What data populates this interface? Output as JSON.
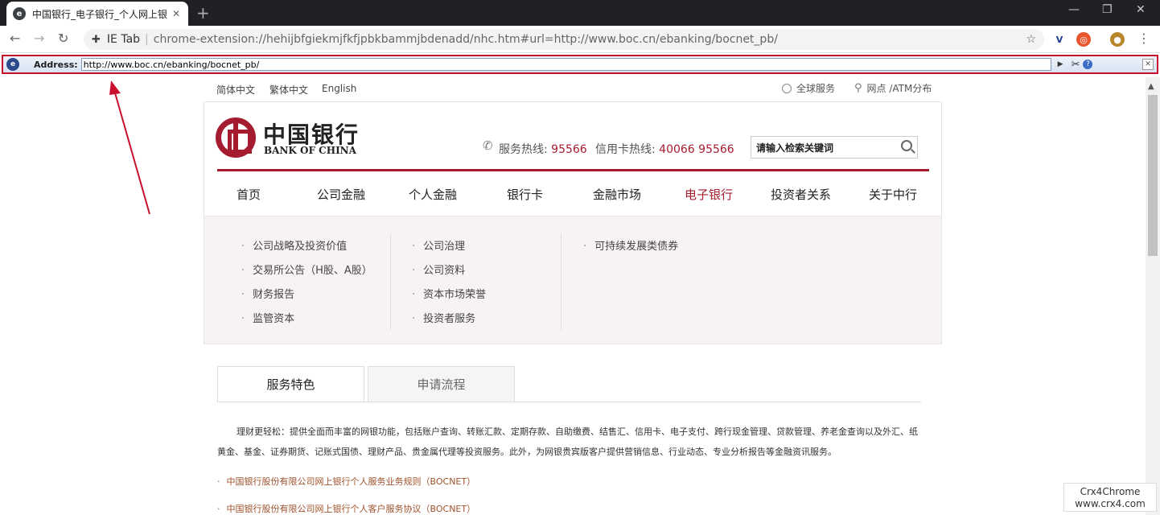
{
  "browser": {
    "tab_title": "中国银行_电子银行_个人网上银行",
    "tab_close": "✕",
    "new_tab": "+",
    "omnibox_prefix": "IE Tab",
    "omnibox_separator": "|",
    "omnibox_url": "chrome-extension://hehijbfgiekmjfkfjpbkbammjbdenadd/nhc.htm#url=http://www.boc.cn/ebanking/bocnet_pb/"
  },
  "ietab": {
    "address_label": "Address:",
    "address_value": "http://www.boc.cn/ebanking/bocnet_pb/",
    "go": "▶",
    "close": "✕",
    "help": "?"
  },
  "page": {
    "languages": [
      "简体中文",
      "繁体中文",
      "English"
    ],
    "global_service": "全球服务",
    "branch_atm": "网点 /ATM分布",
    "logo_cn": "中国银行",
    "logo_en": "BANK OF CHINA",
    "service_hotline_label": "服务热线:",
    "service_hotline": "95566",
    "credit_hotline_label": "信用卡热线:",
    "credit_hotline": "40066 95566",
    "search_placeholder": "请输入检索关键词",
    "nav": [
      "首页",
      "公司金融",
      "个人金融",
      "银行卡",
      "金融市场",
      "电子银行",
      "投资者关系",
      "关于中行"
    ],
    "dropdown": {
      "col1": [
        "公司战略及投资价值",
        "交易所公告（H股、A股）",
        "财务报告",
        "监管资本"
      ],
      "col2": [
        "公司治理",
        "公司资料",
        "资本市场荣誉",
        "投资者服务"
      ],
      "col3": [
        "可持续发展类债券"
      ]
    },
    "tabs": [
      "服务特色",
      "申请流程"
    ],
    "description": "理财更轻松：提供全面而丰富的网银功能，包括账户查询、转账汇款、定期存款、自助缴费、结售汇、信用卡、电子支付、跨行现金管理、贷款管理、养老金查询以及外汇、纸黄金、基金、证券期货、记账式国债、理财产品、贵金属代理等投资服务。此外，为网银贵宾版客户提供营销信息、行业动态、专业分析报告等金融资讯服务。",
    "links": [
      "中国银行股份有限公司网上银行个人服务业务规则（BOCNET）",
      "中国银行股份有限公司网上银行个人客户服务协议（BOCNET）"
    ]
  },
  "watermark": {
    "line1": "Crx4Chrome",
    "line2": "www.crx4.com"
  },
  "colors": {
    "brand": "#a51c30",
    "highlight_border": "#c8102e"
  }
}
